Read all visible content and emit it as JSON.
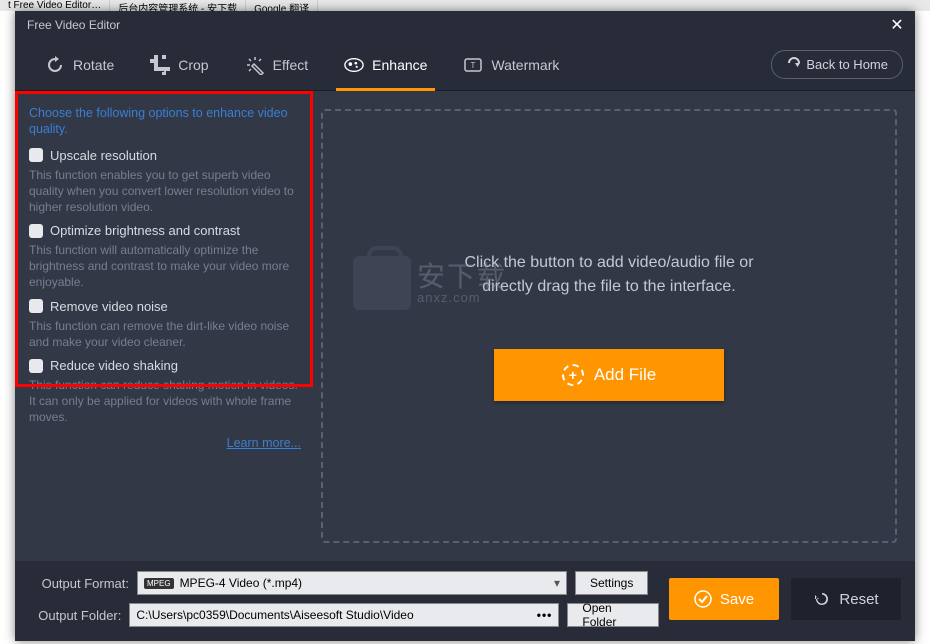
{
  "browserTabs": [
    "t Free Video Editor…",
    "后台内容管理系统 - 安下载",
    "Google 翻译"
  ],
  "window": {
    "title": "Free Video Editor"
  },
  "toolbar": {
    "rotate": "Rotate",
    "crop": "Crop",
    "effect": "Effect",
    "enhance": "Enhance",
    "watermark": "Watermark",
    "backHome": "Back to Home"
  },
  "sidebar": {
    "intro": "Choose the following options to enhance video quality.",
    "options": [
      {
        "label": "Upscale resolution",
        "desc": "This function enables you to get superb video quality when you convert lower resolution video to higher resolution video."
      },
      {
        "label": "Optimize brightness and contrast",
        "desc": "This function will automatically optimize the brightness and contrast to make your video more enjoyable."
      },
      {
        "label": "Remove video noise",
        "desc": "This function can remove the dirt-like video noise and make your video cleaner."
      },
      {
        "label": "Reduce video shaking",
        "desc": "This function can reduce shaking motion in videos. It can only be applied for videos with whole frame moves."
      }
    ],
    "learnMore": "Learn more..."
  },
  "dropArea": {
    "line1": "Click the button to add video/audio file or",
    "line2": "directly drag the file to the interface.",
    "addFile": "Add File"
  },
  "watermark": {
    "cn": "安下载",
    "en": "anxz.com"
  },
  "bottom": {
    "outputFormatLabel": "Output Format:",
    "outputFormatValue": "MPEG-4 Video (*.mp4)",
    "outputFormatBadge": "MPEG",
    "settings": "Settings",
    "outputFolderLabel": "Output Folder:",
    "outputFolderValue": "C:\\Users\\pc0359\\Documents\\Aiseesoft Studio\\Video",
    "openFolder": "Open Folder",
    "save": "Save",
    "reset": "Reset"
  }
}
